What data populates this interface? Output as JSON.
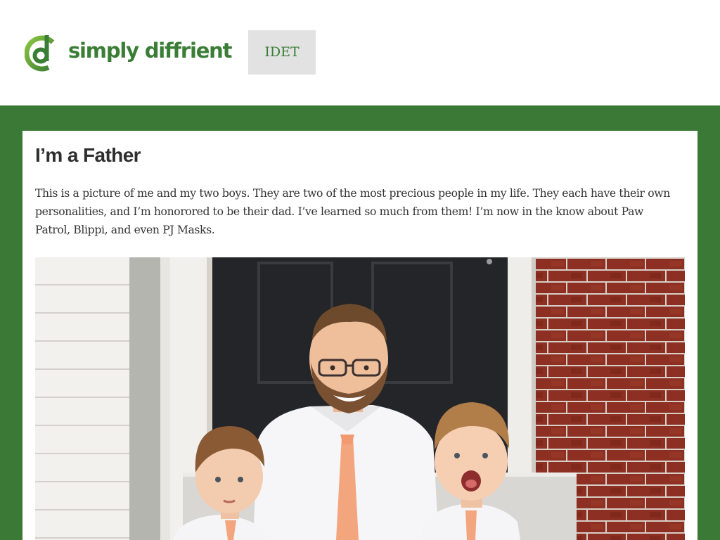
{
  "header": {
    "brand_name": "simply diffrient",
    "logo_icon": "d-logo-icon",
    "nav_button_label": "IDET"
  },
  "post": {
    "title": "I’m a Father",
    "body": "This is a picture of me and my two boys. They are two of the most precious people in my life. They each have their own personalities, and I’m honorored to be their dad. I’ve learned so much from them! I’m now in the know about Paw Patrol, Blippi, and even PJ Masks."
  },
  "colors": {
    "brand_green": "#3a7d35",
    "band_green": "#3a7a36",
    "button_gray": "#e2e2e2",
    "title_text": "#2e2e2e",
    "body_text": "#333333"
  }
}
